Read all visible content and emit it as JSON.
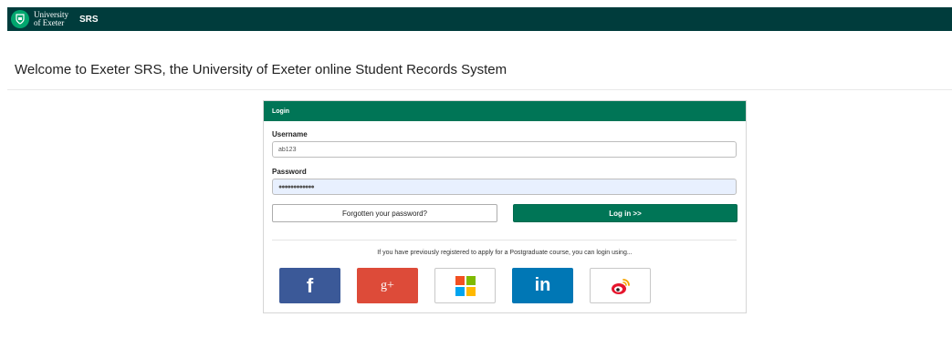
{
  "header": {
    "university_line1": "University",
    "university_line2": "of Exeter",
    "app_name": "SRS",
    "crest_icon": "university-crest-icon"
  },
  "welcome": {
    "text": "Welcome to Exeter SRS, the University of Exeter online Student Records System"
  },
  "login": {
    "heading": "Login",
    "username_label": "Username",
    "username_value": "ab123",
    "password_label": "Password",
    "password_value": "●●●●●●●●●●●●",
    "forgot_label": "Forgotten your password?",
    "login_label": "Log in >>"
  },
  "postgrad": {
    "note": "If you have previously registered to apply for a Postgraduate course, you can login using...",
    "providers": [
      {
        "name": "facebook",
        "glyph": "f",
        "color": "#3b5998"
      },
      {
        "name": "google-plus",
        "glyph": "g+",
        "color": "#dd4b39"
      },
      {
        "name": "microsoft",
        "glyph": "",
        "color": "#ffffff"
      },
      {
        "name": "linkedin",
        "glyph": "in",
        "color": "#0077b5"
      },
      {
        "name": "weibo",
        "glyph": "",
        "color": "#ffffff"
      }
    ]
  },
  "colors": {
    "topbar": "#003c3c",
    "brand_green": "#007556",
    "autofill_blue": "#e8f0fe"
  }
}
